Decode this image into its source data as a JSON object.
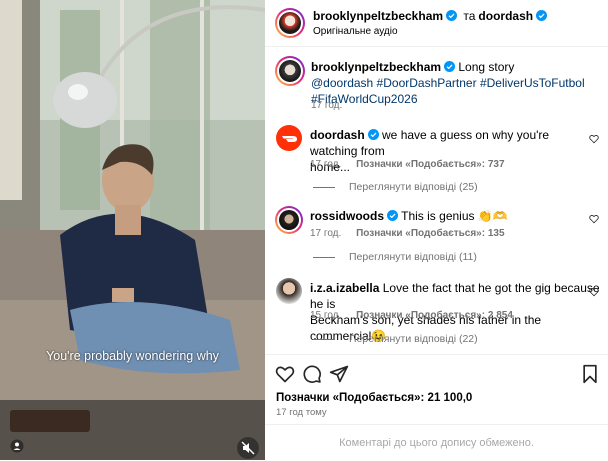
{
  "video": {
    "caption": "You're probably wondering why",
    "icons": [
      "profile-icon",
      "audio-muted-icon"
    ]
  },
  "header": {
    "username": "brooklynpeltzbeckham",
    "joiner": "та",
    "collaborator": "doordash",
    "audio": "Оригінальне аудіо",
    "more_icon": "more-icon"
  },
  "post": {
    "username": "brooklynpeltzbeckham",
    "text": "Long story",
    "tags": "@doordash #DoorDashPartner #DeliverUsToFutbol",
    "tags2": "#FifaWorldCup2026",
    "time": "17 год."
  },
  "comments": [
    {
      "username": "doordash",
      "text_line1": "we have a guess on why you're watching from",
      "text_line2": "home...",
      "time": "17 год.",
      "likes": "Позначки «Подобається»: 737",
      "replies": "Переглянути відповіді (25)"
    },
    {
      "username": "rossidwoods",
      "text_line1": "This is genius 👏🫶",
      "time": "17 год.",
      "likes": "Позначки «Подобається»: 135",
      "replies": "Переглянути відповіді (11)"
    },
    {
      "username": "i.z.a.izabella",
      "text_line1": "Love the fact that he got the gig because he is",
      "text_line2": "Beckham's son, yet shades his father in the commercial😉",
      "time": "15 год.",
      "likes": "Позначки «Подобається»: 2 854",
      "replies": "Переглянути відповіді (22)"
    }
  ],
  "actions": {
    "likes": "Позначки «Подобається»: 21 100,0",
    "time": "17 год тому",
    "icons": [
      "heart-icon",
      "comment-icon",
      "share-icon",
      "save-icon"
    ]
  },
  "footer": {
    "notice": "Коментарі до цього допису обмежено."
  },
  "colors": {
    "link": "#00376b",
    "verified": "#0095f6",
    "doordash": "#ff3008",
    "muted": "#737373"
  }
}
